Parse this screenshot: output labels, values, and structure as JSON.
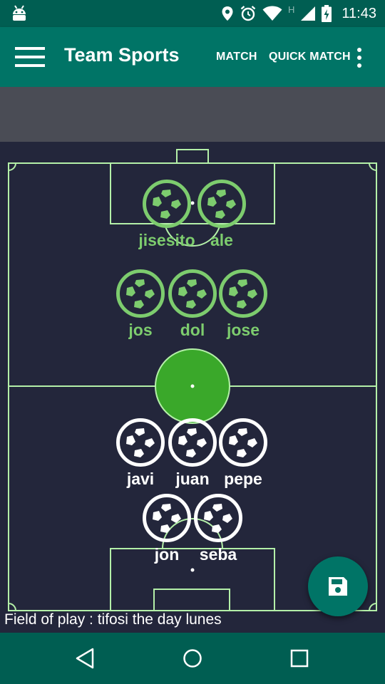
{
  "status_bar": {
    "time": "11:43",
    "network_mark": "H",
    "icons": [
      "android-debug-icon",
      "location-icon",
      "alarm-icon",
      "wifi-icon",
      "signal-icon",
      "battery-charging-icon"
    ]
  },
  "app_bar": {
    "title": "Team Sports",
    "actions": [
      {
        "label": "MATCH"
      },
      {
        "label": "QUICK MATCH"
      }
    ],
    "menu_icon": "hamburger-menu-icon",
    "overflow_icon": "more-vert-icon"
  },
  "field": {
    "colors": {
      "background": "#23263b",
      "lines": "#b4f0a8",
      "center_circle": "#3aa82a",
      "team_green": "#7dcc6e",
      "team_white": "#ffffff"
    },
    "team_top": {
      "players": [
        {
          "name": "jisesito"
        },
        {
          "name": "ale"
        },
        {
          "name": "jos"
        },
        {
          "name": "dol"
        },
        {
          "name": "jose"
        }
      ]
    },
    "team_bottom": {
      "players": [
        {
          "name": "javi"
        },
        {
          "name": "juan"
        },
        {
          "name": "pepe"
        },
        {
          "name": "jon"
        },
        {
          "name": "seba"
        }
      ]
    },
    "caption": "Field of play : tifosi the day lunes"
  },
  "fab": {
    "icon": "save-icon",
    "color": "#007466"
  },
  "nav_bar": {
    "icons": [
      "back-icon",
      "home-icon",
      "recents-icon"
    ]
  }
}
